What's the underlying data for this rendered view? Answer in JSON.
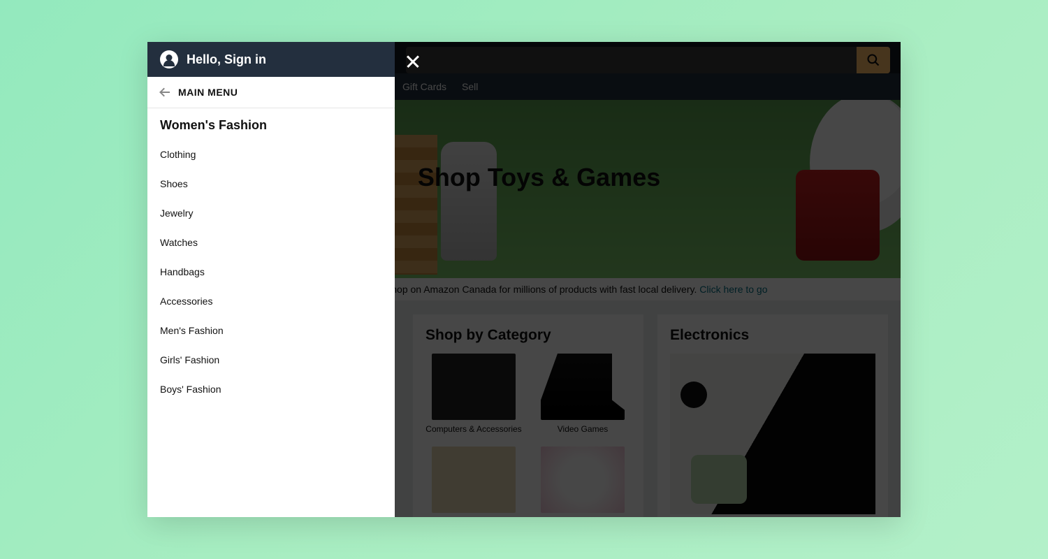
{
  "sidemenu": {
    "greeting": "Hello, Sign in",
    "back_label": "MAIN MENU",
    "section_title": "Women's Fashion",
    "items": [
      "Clothing",
      "Shoes",
      "Jewelry",
      "Watches",
      "Handbags",
      "Accessories",
      "Men's Fashion",
      "Girls' Fashion",
      "Boys' Fashion"
    ]
  },
  "subnav": {
    "items": [
      "Gift Cards",
      "Sell"
    ]
  },
  "hero": {
    "title": "Shop Toys & Games"
  },
  "notice": {
    "text_fragment": "azon.com. You can also shop on Amazon Canada for millions of products with fast local delivery. ",
    "link_text": "Click here to go"
  },
  "cards": {
    "category": {
      "title": "Shop by Category",
      "items": [
        "Computers & Accessories",
        "Video Games"
      ]
    },
    "electronics": {
      "title": "Electronics"
    }
  }
}
